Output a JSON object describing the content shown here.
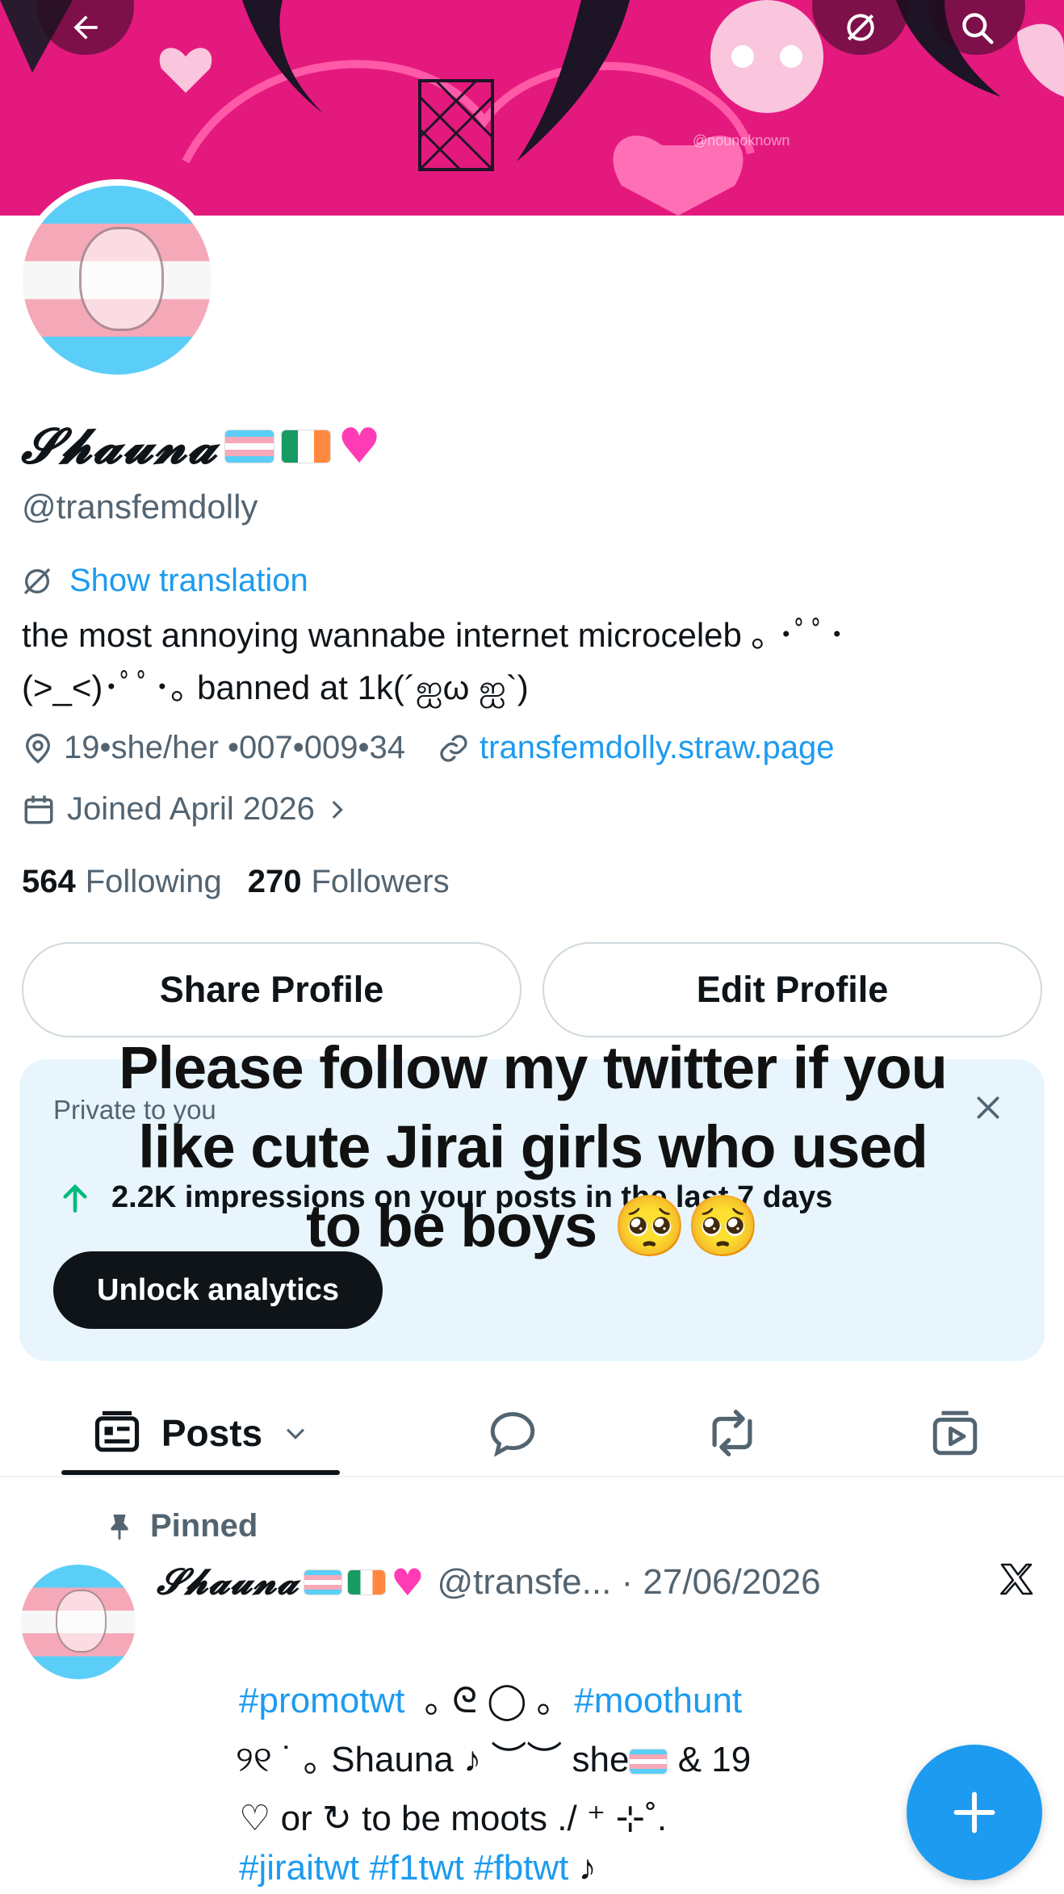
{
  "banner": {
    "watermark": "@nounoknown"
  },
  "profile": {
    "display_name": "𝓢𝓱𝓪𝓾𝓷𝓪",
    "handle": "@transfemdolly",
    "translate_label": "Show translation",
    "bio_line1": "the most annoying wannabe internet microceleb ｡ ･ﾟﾟ･",
    "bio_line2": "(>_<)･ﾟﾟ･｡ banned at 1k(´ஐω ஐ`)",
    "location": "19•she/her •007•009•34",
    "website": "transfemdolly.straw.page",
    "joined": "Joined April 2026",
    "following_count": "564",
    "following_label": "Following",
    "followers_count": "270",
    "followers_label": "Followers"
  },
  "buttons": {
    "share": "Share Profile",
    "edit": "Edit Profile"
  },
  "analytics": {
    "private_label": "Private to you",
    "impressions": "2.2K impressions on your posts in the last 7 days",
    "unlock": "Unlock analytics"
  },
  "overlay": {
    "line1": "Please follow my twitter if you",
    "line2": "like cute Jirai girls who used",
    "line3": "to be boys 🥺🥺"
  },
  "tabs": {
    "posts": "Posts"
  },
  "pinned_post": {
    "pinned_label": "Pinned",
    "author_name": "𝓢𝓱𝓪𝓾𝓷𝓪",
    "handle_date": "@transfe... · 27/06/2026",
    "tag1": "#promotwt",
    "deco1": "  ｡ ᘓ ◯ ｡  ",
    "tag2": "#moothunt",
    "line2": "୨୧ ˙ ｡ Shauna ♪ ︶︶ she",
    "line2_end": " & 19",
    "line3": "♡ or ↻ to be moots ./ ⁺ ⊹˚.",
    "tag3": "#jiraitwt",
    "tag4": "#f1twt",
    "tag5": "#fbtwt",
    "line4_end": " ♪"
  },
  "colors": {
    "accent": "#1d9bf0",
    "banner": "#e4197e",
    "analytics_bg": "#e8f5fd",
    "muted": "#536471"
  }
}
